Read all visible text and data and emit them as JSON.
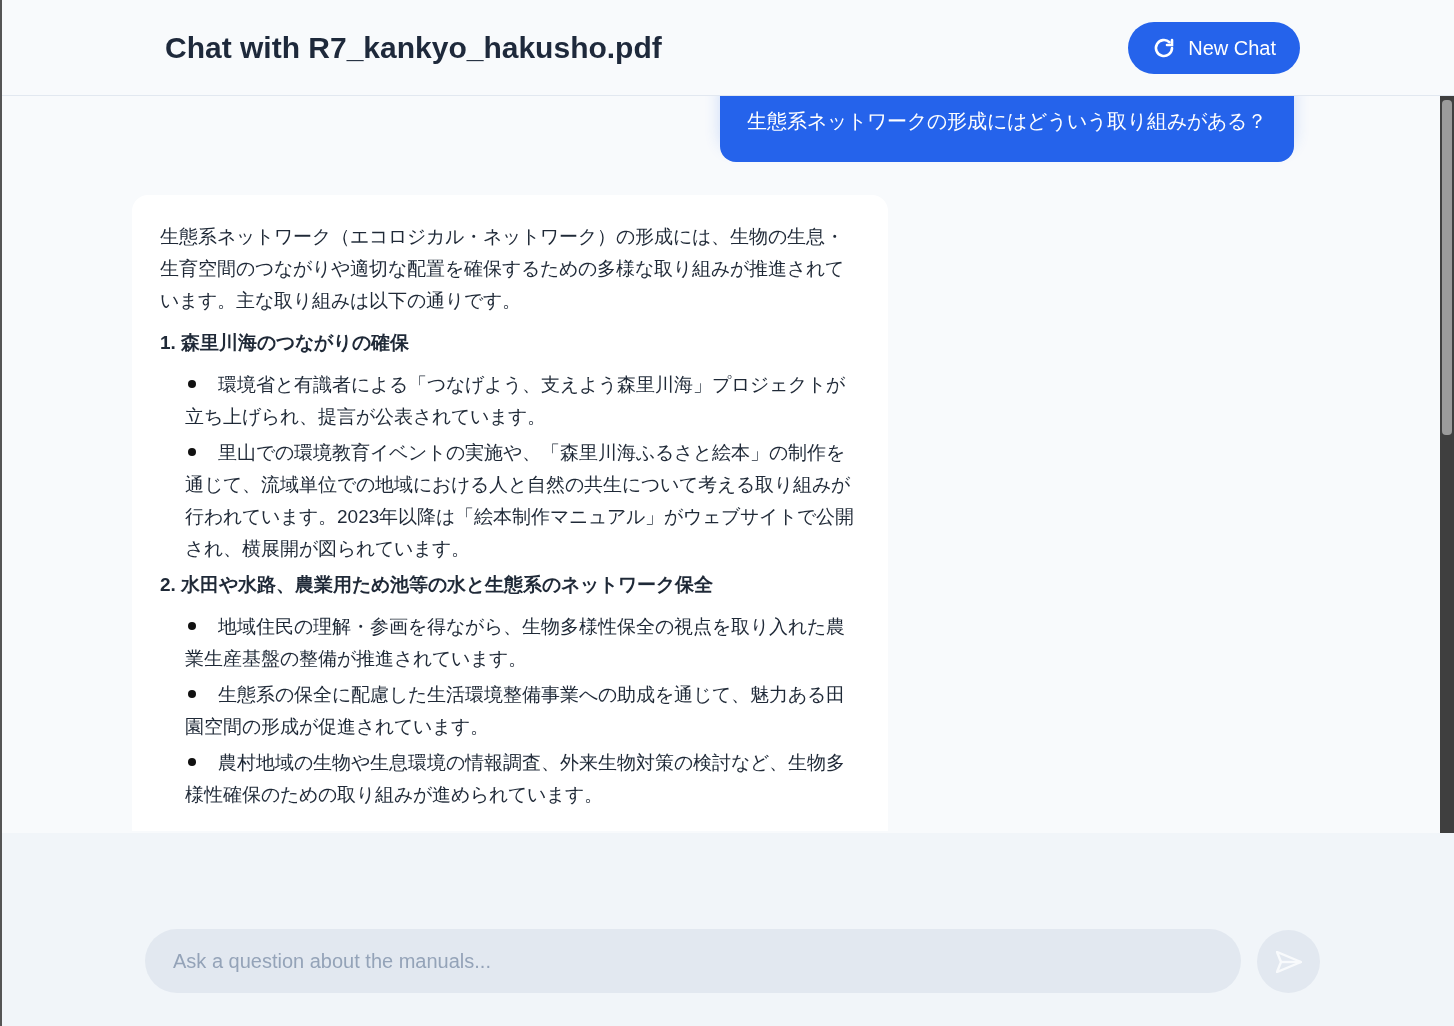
{
  "header": {
    "title": "Chat with R7_kankyo_hakusho.pdf",
    "new_chat_button": "New Chat"
  },
  "messages": [
    {
      "kind": "user",
      "text": "生態系ネットワークの形成にはどういう取り組みがある？"
    },
    {
      "kind": "assistant",
      "blocks": [
        {
          "kind": "paragraph",
          "text": "生態系ネットワーク（エコロジカル・ネットワーク）の形成には、生物の生息・生育空間のつながりや適切な配置を確保するための多様な取り組みが推進されています。主な取り組みは以下の通りです。"
        },
        {
          "kind": "heading",
          "text": "1. 森里川海のつながりの確保"
        },
        {
          "kind": "bullet",
          "text": "環境省と有識者による「つなげよう、支えよう森里川海」プロジェクトが立ち上げられ、提言が公表されています。"
        },
        {
          "kind": "bullet",
          "text": "里山での環境教育イベントの実施や、「森里川海ふるさと絵本」の制作を通じて、流域単位での地域における人と自然の共生について考える取り組みが行われています。2023年以降は「絵本制作マニュアル」がウェブサイトで公開され、横展開が図られています。"
        },
        {
          "kind": "heading",
          "text": "2. 水田や水路、農業用ため池等の水と生態系のネットワーク保全"
        },
        {
          "kind": "bullet",
          "text": "地域住民の理解・参画を得ながら、生物多様性保全の視点を取り入れた農業生産基盤の整備が推進されています。"
        },
        {
          "kind": "bullet",
          "text": "生態系の保全に配慮した生活環境整備事業への助成を通じて、魅力ある田園空間の形成が促進されています。"
        },
        {
          "kind": "bullet",
          "text": "農村地域の生物や生息環境の情報調査、外来生物対策の検討など、生物多様性確保のための取り組みが進められています。"
        }
      ]
    }
  ],
  "composer": {
    "placeholder": "Ask a question about the manuals..."
  }
}
